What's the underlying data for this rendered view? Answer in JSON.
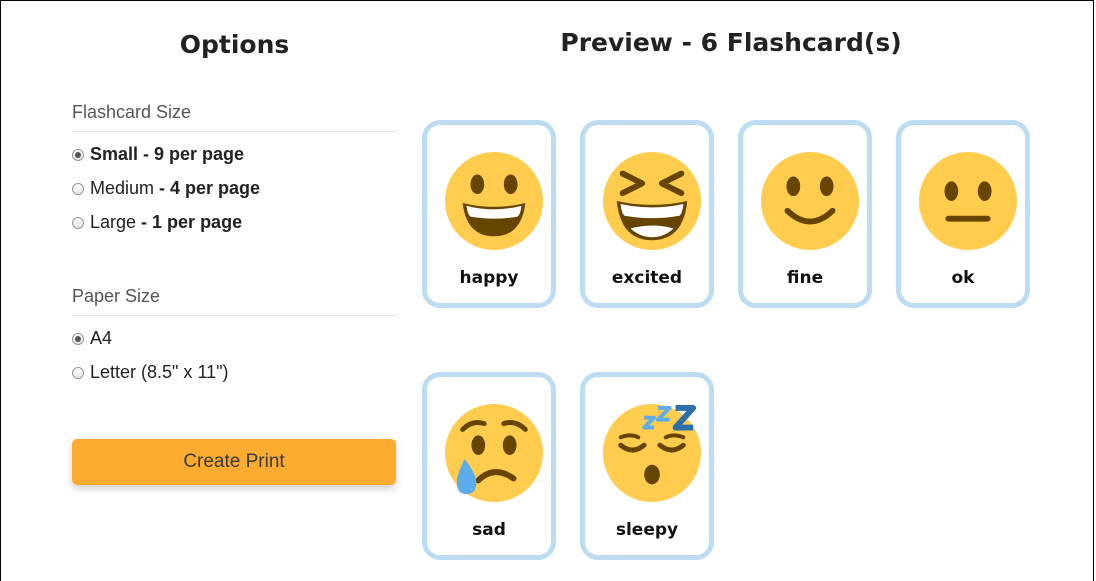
{
  "options": {
    "title": "Options",
    "flashcard_size": {
      "label": "Flashcard Size",
      "choices": [
        {
          "name": "Small",
          "detail": " - 9 per page",
          "checked": true
        },
        {
          "name": "Medium",
          "detail": " - 4 per page",
          "checked": false
        },
        {
          "name": "Large",
          "detail": " - 1 per page",
          "checked": false
        }
      ]
    },
    "paper_size": {
      "label": "Paper Size",
      "choices": [
        {
          "name": "A4",
          "checked": true
        },
        {
          "name": "Letter (8.5\" x 11\")",
          "checked": false
        }
      ]
    },
    "create_button": "Create Print"
  },
  "preview": {
    "title": "Preview - 6 Flashcard(s)",
    "cards": [
      {
        "label": "happy",
        "icon": "grinning-face-icon"
      },
      {
        "label": "excited",
        "icon": "grinning-squinting-face-icon"
      },
      {
        "label": "fine",
        "icon": "slightly-smiling-face-icon"
      },
      {
        "label": "ok",
        "icon": "neutral-face-icon"
      },
      {
        "label": "sad",
        "icon": "crying-face-icon"
      },
      {
        "label": "sleepy",
        "icon": "sleeping-face-icon"
      }
    ]
  },
  "colors": {
    "accent_button": "#fbab2f",
    "card_border": "#bcdcf4",
    "emoji_face": "#ffcc4d",
    "emoji_features": "#664500"
  }
}
